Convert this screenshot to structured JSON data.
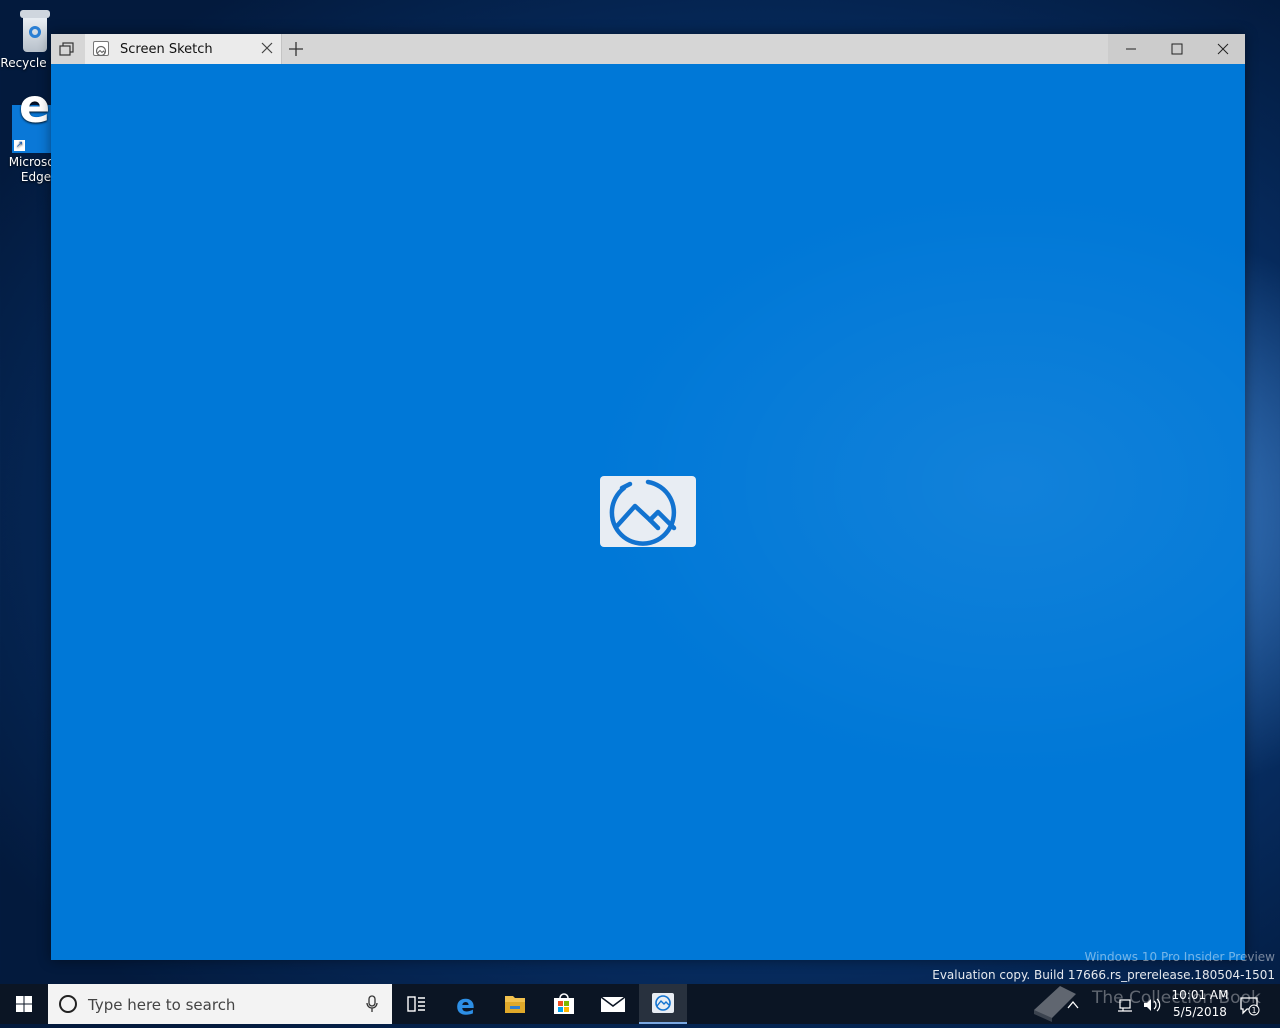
{
  "desktop": {
    "icons": [
      {
        "label": "Recycle Bin"
      },
      {
        "label": "Microsoft Edge"
      }
    ]
  },
  "window": {
    "tab_title": "Screen Sketch",
    "app_name": "Screen Sketch"
  },
  "watermark": {
    "edition": "Windows 10 Pro Insider Preview",
    "build": "Evaluation copy. Build 17666.rs_prerelease.180504-1501",
    "site": "The Collection Book"
  },
  "taskbar": {
    "search_placeholder": "Type here to search",
    "pinned": [
      "task-view",
      "microsoft-edge",
      "file-explorer",
      "microsoft-store",
      "mail",
      "screen-sketch"
    ],
    "active_app": "screen-sketch"
  },
  "tray": {
    "time": "10:01 AM",
    "date": "5/5/2018",
    "notification_count": "1"
  },
  "colors": {
    "accent": "#0078d7",
    "titlebar": "#d6d6d6",
    "taskbar": "#0b1524"
  }
}
